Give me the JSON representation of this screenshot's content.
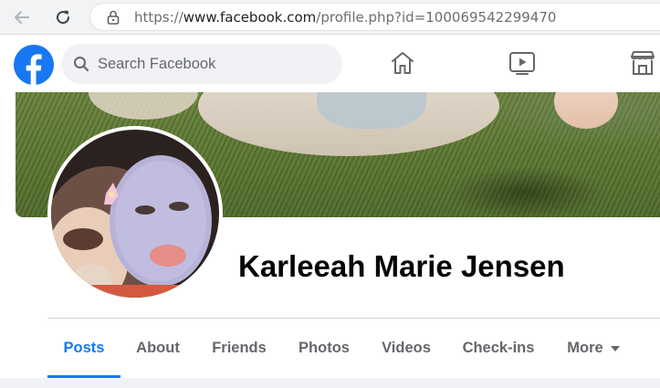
{
  "browser": {
    "url_scheme": "https://",
    "url_host": "www.facebook.com",
    "url_path": "/profile.php?id=100069542299470",
    "back_icon": "arrow-left-icon",
    "reload_icon": "reload-icon",
    "lock_icon": "lock-icon"
  },
  "header": {
    "logo_icon": "facebook-logo",
    "search_placeholder": "Search Facebook",
    "nav_icons": [
      "home-icon",
      "watch-icon",
      "marketplace-icon"
    ]
  },
  "profile": {
    "name": "Karleeah Marie Jensen"
  },
  "tabs": [
    {
      "label": "Posts",
      "active": true
    },
    {
      "label": "About"
    },
    {
      "label": "Friends"
    },
    {
      "label": "Photos"
    },
    {
      "label": "Videos"
    },
    {
      "label": "Check-ins"
    },
    {
      "label": "More"
    }
  ],
  "colors": {
    "brand": "#1877f2",
    "text_primary": "#050505",
    "text_secondary": "#65676b"
  }
}
